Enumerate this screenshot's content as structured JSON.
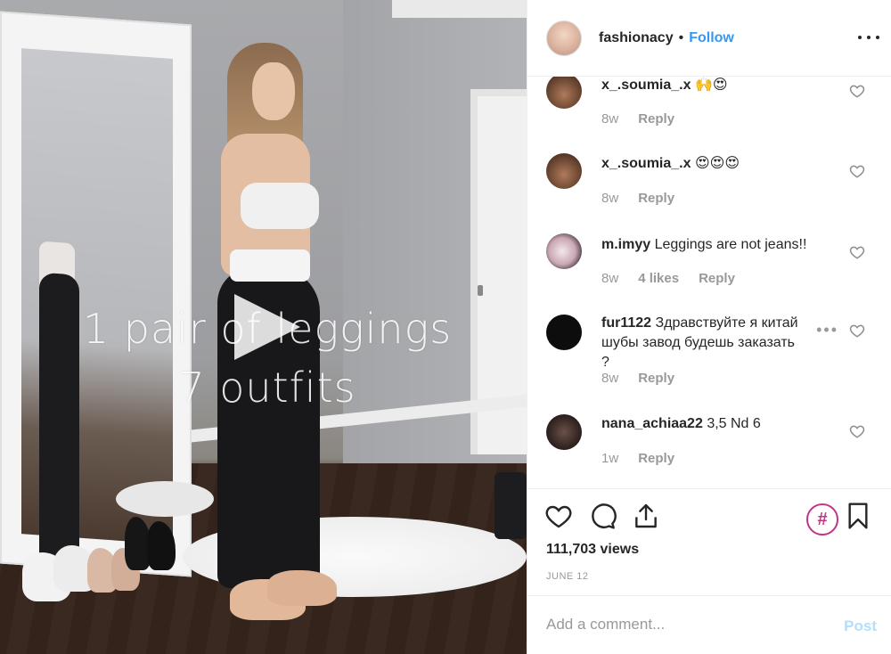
{
  "media": {
    "overlay_line1": "1 pair of leggings",
    "overlay_line2": "7 outfits"
  },
  "header": {
    "username": "fashionacy",
    "separator": "•",
    "follow_label": "Follow"
  },
  "comments": [
    {
      "username": "x_.soumia_.x",
      "text": "🙌😍",
      "age": "8w",
      "likes": "",
      "reply_label": "Reply"
    },
    {
      "username": "x_.soumia_.x",
      "text": "😍😍😍",
      "age": "8w",
      "likes": "",
      "reply_label": "Reply"
    },
    {
      "username": "m.imyy",
      "text": "Leggings are not jeans!!",
      "age": "8w",
      "likes": "4 likes",
      "reply_label": "Reply"
    },
    {
      "username": "fur1122",
      "text": "Здравствуйте я китай шубы завод будешь заказать ?",
      "age": "8w",
      "likes": "",
      "reply_label": "Reply"
    },
    {
      "username": "nana_achiaa22",
      "text": "3,5 Nd 6",
      "age": "1w",
      "likes": "",
      "reply_label": "Reply"
    }
  ],
  "stats": {
    "views": "111,703 views",
    "date": "JUNE 12"
  },
  "composer": {
    "placeholder": "Add a comment...",
    "post_label": "Post"
  },
  "icons": {
    "like": "heart-icon",
    "comment": "comment-bubble-icon",
    "share": "share-icon",
    "hashtag": "hashtag-icon",
    "save": "bookmark-icon",
    "options": "more-horizontal-icon"
  },
  "colors": {
    "link_blue": "#3897f0",
    "post_disabled": "#b2dffc",
    "hashtag_accent": "#c13584",
    "muted_text": "#999999"
  }
}
